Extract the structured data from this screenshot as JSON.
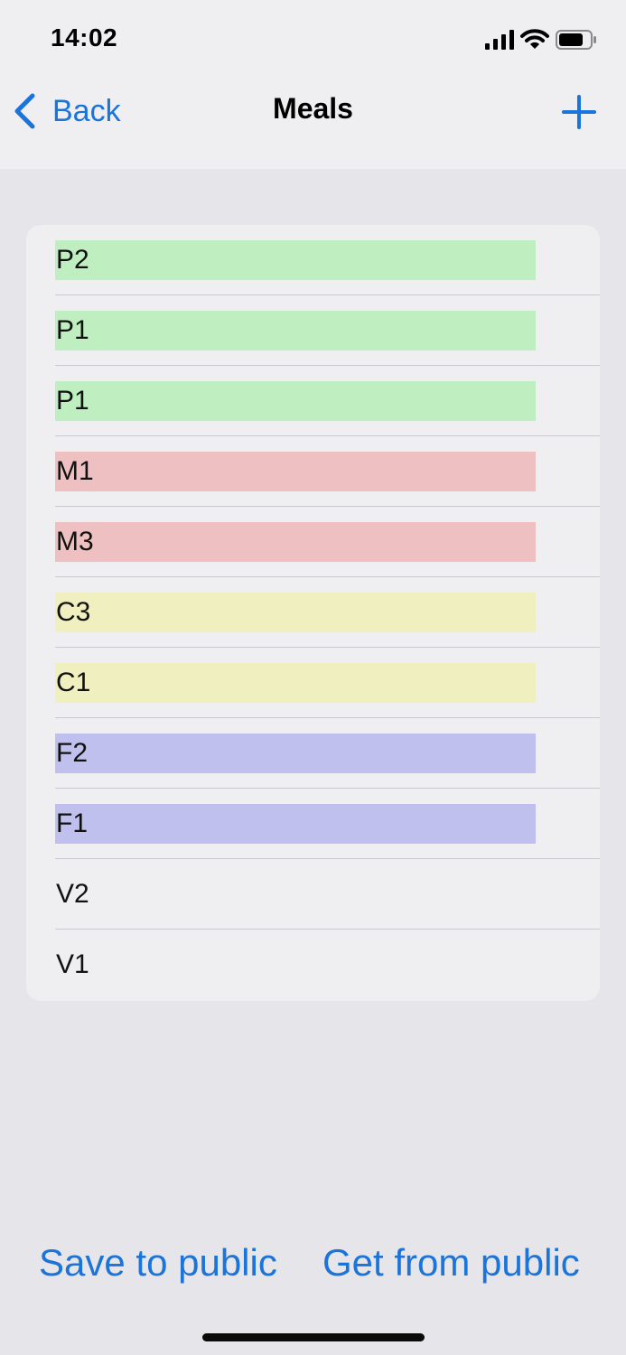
{
  "status_bar": {
    "time": "14:02",
    "icons": [
      "cellular-signal-icon",
      "wifi-icon",
      "battery-icon"
    ]
  },
  "nav_bar": {
    "back_label": "Back",
    "title": "Meals",
    "add_icon": "plus-icon"
  },
  "meals": [
    {
      "label": "P2",
      "color": "#bfefc1"
    },
    {
      "label": "P1",
      "color": "#bfefc1"
    },
    {
      "label": "P1",
      "color": "#bfefc1"
    },
    {
      "label": "M1",
      "color": "#efc0c1"
    },
    {
      "label": "M3",
      "color": "#efc0c1"
    },
    {
      "label": "C3",
      "color": "#efefc0"
    },
    {
      "label": "C1",
      "color": "#efefc0"
    },
    {
      "label": "F2",
      "color": "#c0c0ef"
    },
    {
      "label": "F1",
      "color": "#c0c0ef"
    },
    {
      "label": "V2",
      "color": null
    },
    {
      "label": "V1",
      "color": null
    }
  ],
  "toolbar": {
    "save_label": "Save to public",
    "get_label": "Get from public"
  },
  "colors": {
    "accent": "#1a74d9",
    "background": "#e5e5ea",
    "list_background": "#efeff1"
  }
}
